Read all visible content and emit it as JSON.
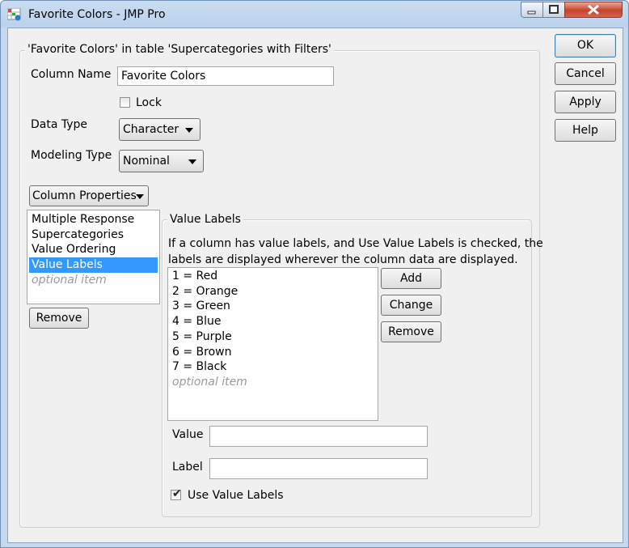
{
  "window": {
    "title": "Favorite Colors - JMP Pro"
  },
  "group_title": "'Favorite Colors' in table 'Supercategories with Filters'",
  "column_name": {
    "label": "Column Name",
    "value": "Favorite Colors"
  },
  "lock": {
    "label": "Lock",
    "checked": false
  },
  "data_type": {
    "label": "Data Type",
    "value": "Character"
  },
  "modeling_type": {
    "label": "Modeling Type",
    "value": "Nominal"
  },
  "column_properties_button": "Column Properties",
  "properties_list": {
    "items": [
      "Multiple Response",
      "Supercategories",
      "Value Ordering",
      "Value Labels"
    ],
    "selected": "Value Labels",
    "placeholder": "optional item"
  },
  "remove_property_button": "Remove",
  "value_labels": {
    "title": "Value Labels",
    "description_line1": "If a column has value labels, and Use Value Labels is checked, the",
    "description_line2": "labels are displayed wherever the column data are displayed.",
    "items": [
      "1 = Red",
      "2 = Orange",
      "3 = Green",
      "4 = Blue",
      "5 = Purple",
      "6 = Brown",
      "7 = Black"
    ],
    "placeholder": "optional item",
    "add_button": "Add",
    "change_button": "Change",
    "remove_button": "Remove",
    "value_label": "Value",
    "value_input": "",
    "label_label": "Label",
    "label_input": "",
    "use_value_labels": {
      "label": "Use Value Labels",
      "checked": true
    }
  },
  "dialog_buttons": {
    "ok": "OK",
    "cancel": "Cancel",
    "apply": "Apply",
    "help": "Help"
  },
  "colors": {
    "selection": "#3399ff",
    "titlebar": "#c5d8ee",
    "close": "#c5432c"
  }
}
